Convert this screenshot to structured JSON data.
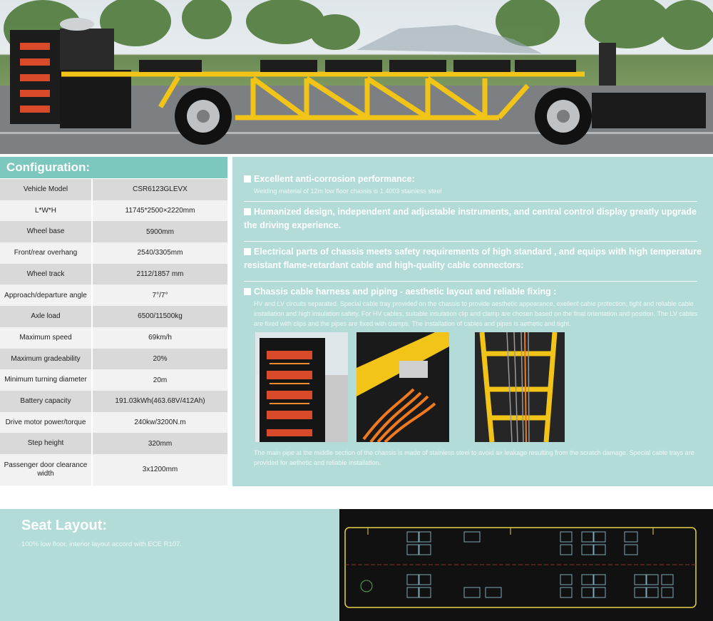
{
  "hero": {
    "image": "electric bus chassis photo"
  },
  "configuration": {
    "title": "Configuration:",
    "rows": [
      {
        "label": "Vehicle Model",
        "value": "CSR6123GLEVX"
      },
      {
        "label": "L*W*H",
        "value": "11745*2500×2220mm"
      },
      {
        "label": "Wheel base",
        "value": "5900mm"
      },
      {
        "label": "Front/rear overhang",
        "value": "2540/3305mm"
      },
      {
        "label": "Wheel track",
        "value": "2112/1857 mm"
      },
      {
        "label": "Approach/departure angle",
        "value": "7°/7°"
      },
      {
        "label": "Axle load",
        "value": "6500/11500kg"
      },
      {
        "label": "Maximum speed",
        "value": "69km/h"
      },
      {
        "label": "Maximum  gradeability",
        "value": "20%"
      },
      {
        "label": "Minimum turning diameter",
        "value": "20m"
      },
      {
        "label": "Battery capacity",
        "value": "191.03kWh(463.68V/412Ah)"
      },
      {
        "label": "Drive motor power/torque",
        "value": "240kw/3200N.m"
      },
      {
        "label": "Step height",
        "value": "320mm"
      },
      {
        "label": "Passenger door clearance width",
        "value": "3x1200mm"
      }
    ]
  },
  "features": {
    "f1": {
      "title": "Excellent anti-corrosion performance:",
      "text": "Welding material of 12m low floor chassis is 1.4003 stainless steel"
    },
    "f2": {
      "title": "Humanized design,  independent and adjustable instruments,  and central  control  display  greatly upgrade the driving experience."
    },
    "f3": {
      "title": "Electrical parts of chassis meets safety requirements of high standard , and equips with high temperature resistant flame-retardant cable and high-quality cable connectors:"
    },
    "f4": {
      "title": "Chassis cable harness and piping - aesthetic layout and reliable fixing :",
      "text": "HV and LV circuits separated. Special cable tray provided on the chassis to provide aesthetic appearance, exellent cable protection, tight and reliable cable installation and high insulation safety. For HV cables, suitable insulation clip and clamp are chosen based on the final orientation and position. The LV cables are fixed with clips and the pipes are fixed with clamps. The installation of cables and pipes is aethetic and tight."
    },
    "footer": "The main pipe at the middle section of the chassis is made of stainless steel to avoid air leakage resulting from the scratch damage. Special cable trays are provided for aethetic and reliable installation."
  },
  "seat_layout": {
    "title": "Seat Layout:",
    "text": "100% low floor, interior layout accord with ECE R107."
  },
  "colors": {
    "accent": "#7cc7be",
    "panel": "#b3dcd8",
    "frame": "#f2c418"
  }
}
